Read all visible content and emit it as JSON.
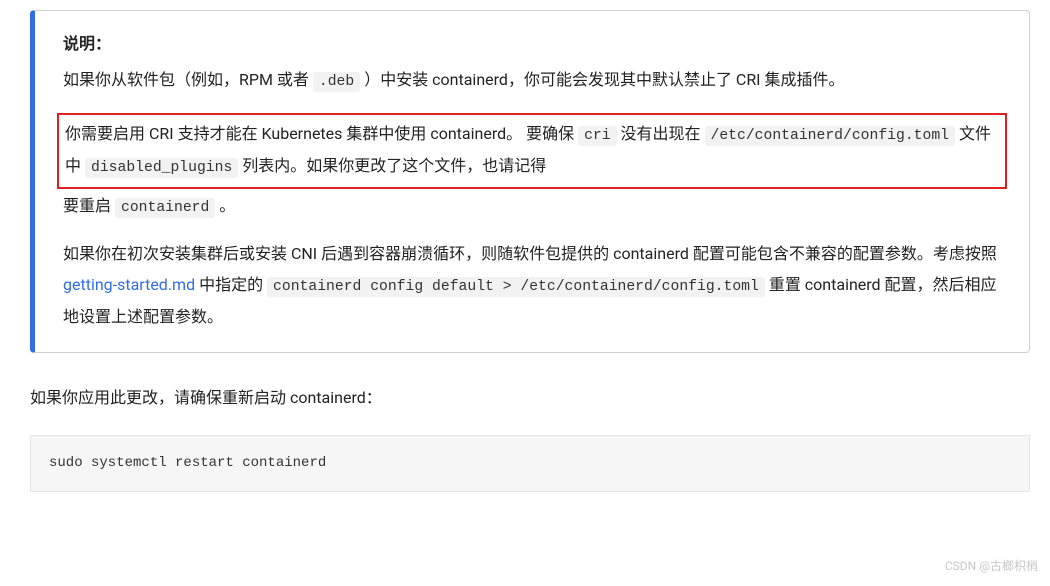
{
  "note": {
    "title": "说明：",
    "para1_a": "如果你从软件包（例如，RPM 或者 ",
    "para1_code1": ".deb",
    "para1_b": " ）中安装 containerd，你可能会发现其中默认禁止了 CRI 集成插件。",
    "highlight": {
      "a": "你需要启用 CRI 支持才能在 Kubernetes 集群中使用 containerd。 要确保 ",
      "code1": "cri",
      "b": " 没有出现在 ",
      "code2": "/etc/containerd/config.toml",
      "c": " 文件中 ",
      "code3": "disabled_plugins",
      "d": " 列表内。如果你更改了这个文件，也请记得"
    },
    "para2_tail_a": "要重启 ",
    "para2_tail_code": "containerd",
    "para2_tail_b": " 。",
    "para3_a": "如果你在初次安装集群后或安装 CNI 后遇到容器崩溃循环，则随软件包提供的 containerd 配置可能包含不兼容的配置参数。考虑按照 ",
    "para3_link": "getting-started.md",
    "para3_b": " 中指定的 ",
    "para3_code1": "containerd config default > /etc/containerd/config.toml",
    "para3_c": " 重置 containerd 配置，然后相应地设置上述配置参数。"
  },
  "outer_para": "如果你应用此更改，请确保重新启动 containerd：",
  "code_block": "sudo systemctl restart containerd",
  "watermark": "CSDN @古榔枳梢"
}
